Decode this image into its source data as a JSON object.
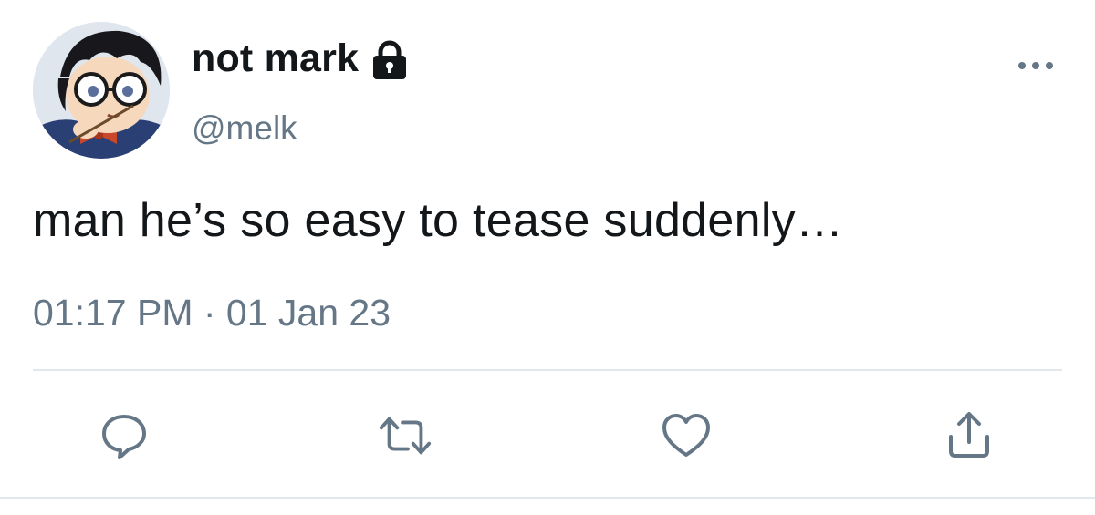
{
  "tweet": {
    "display_name": "not mark",
    "handle": "@melk",
    "text": "man he’s so easy to tease suddenly…",
    "timestamp": "01:17 PM · 01 Jan 23",
    "protected": true
  },
  "icons": {
    "lock": "lock-icon",
    "more": "more-horizontal-icon",
    "reply": "reply-icon",
    "retweet": "retweet-icon",
    "like": "heart-icon",
    "share": "share-icon"
  },
  "colors": {
    "text": "#14171a",
    "secondary": "#657786",
    "divider": "#e1e8ed",
    "icon": "#657786"
  }
}
